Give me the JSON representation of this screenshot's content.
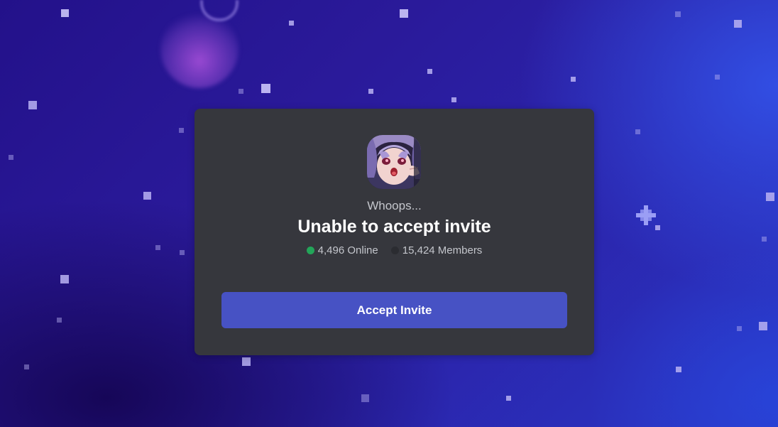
{
  "invite": {
    "subtitle": "Whoops...",
    "title": "Unable to accept invite",
    "online_count": "4,496 Online",
    "member_count": "15,424 Members",
    "accept_label": "Accept Invite"
  },
  "colors": {
    "card_bg": "#36373d",
    "button_bg": "#4752c4",
    "online_dot": "#23a559",
    "members_dot": "#2b2c31",
    "background_primary": "#2a1a9a",
    "background_accent": "#2a37c6"
  },
  "icons": {
    "server_avatar": "server-avatar-anime-icon",
    "online_status": "online-status-dot-icon",
    "members_status": "members-status-dot-icon"
  }
}
